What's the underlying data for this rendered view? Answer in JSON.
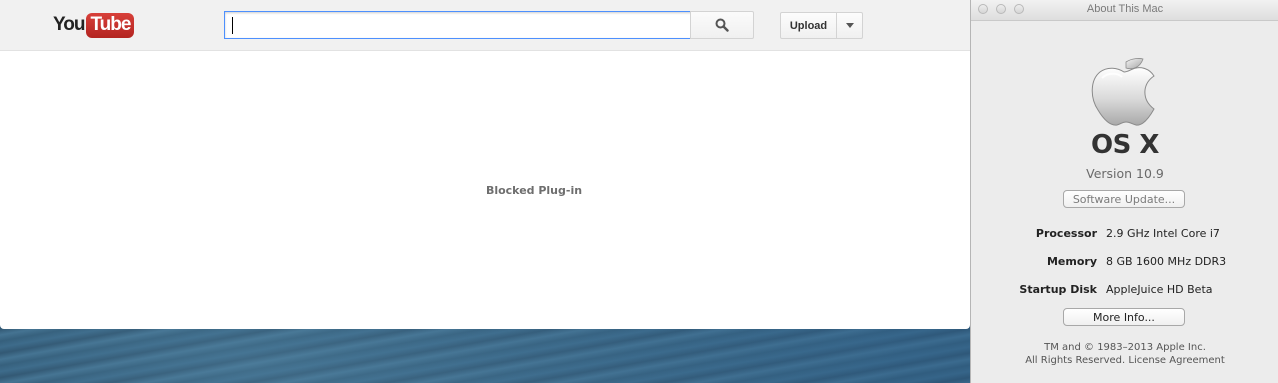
{
  "browser": {
    "logo": {
      "part1": "You",
      "part2": "Tube"
    },
    "search": {
      "value": "",
      "placeholder": ""
    },
    "search_icon": "search-icon",
    "upload_label": "Upload",
    "upload_menu_icon": "chevron-down-icon",
    "content_message": "Blocked Plug-in"
  },
  "about_window": {
    "title": "About This Mac",
    "os_name": "OS X",
    "version": "Version 10.9",
    "software_update_label": "Software Update...",
    "specs": [
      {
        "label": "Processor",
        "value": "2.9 GHz Intel Core i7"
      },
      {
        "label": "Memory",
        "value": "8 GB 1600 MHz DDR3"
      },
      {
        "label": "Startup Disk",
        "value": "AppleJuice HD Beta"
      }
    ],
    "more_info_label": "More Info...",
    "footer_line1": "TM and © 1983–2013 Apple Inc.",
    "footer_line2": "All Rights Reserved.  License Agreement"
  },
  "colors": {
    "youtube_red": "#c4302b",
    "focus_blue": "#4d90fe",
    "window_bg": "#ececec"
  }
}
